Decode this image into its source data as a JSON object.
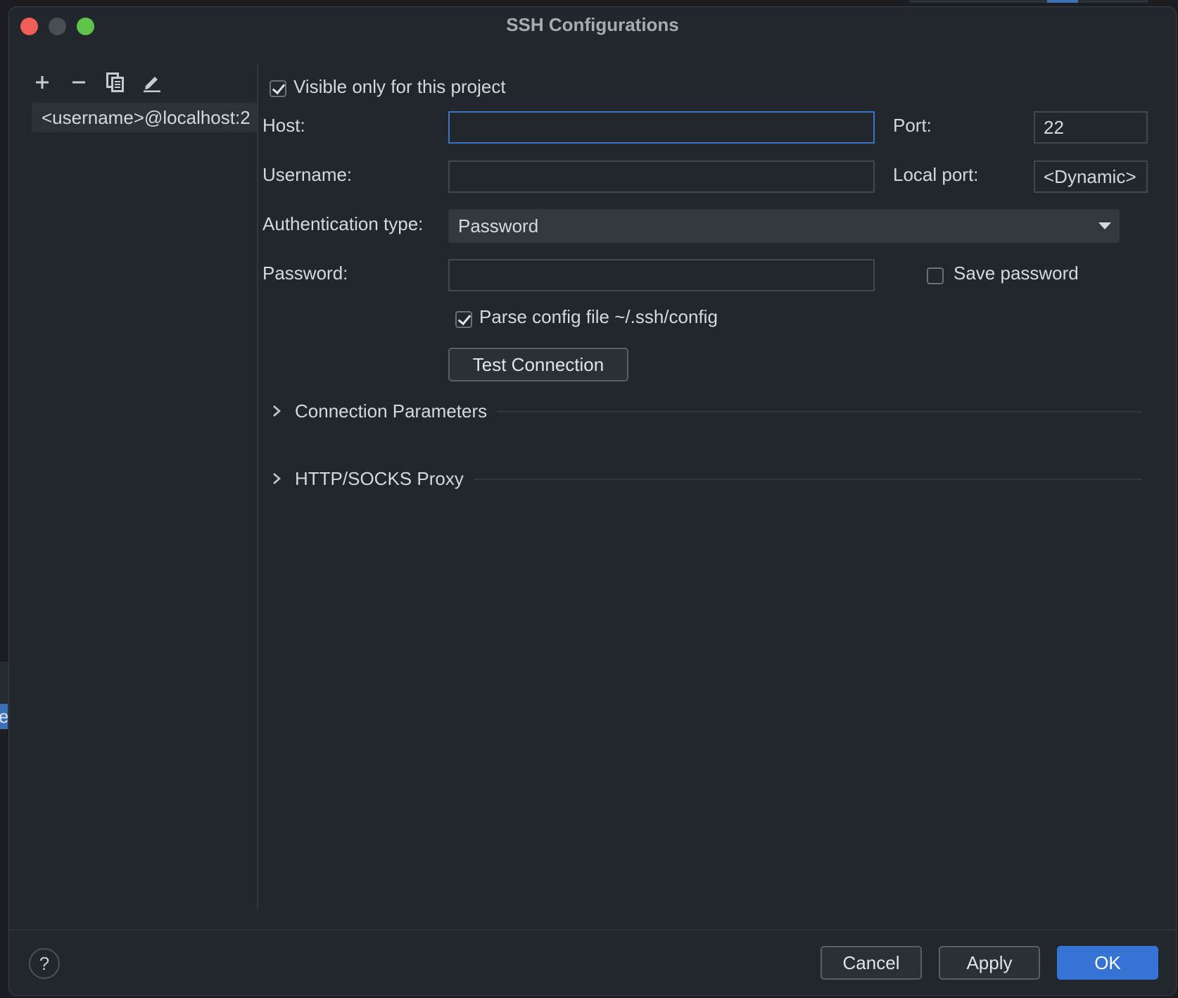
{
  "window": {
    "title": "SSH Configurations"
  },
  "backdrop": {
    "selected_fragment": "e"
  },
  "sidebar": {
    "toolbar": [
      {
        "name": "add-icon"
      },
      {
        "name": "remove-icon"
      },
      {
        "name": "copy-icon"
      },
      {
        "name": "edit-icon"
      }
    ],
    "items": [
      {
        "label": "<username>@localhost:2"
      }
    ]
  },
  "form": {
    "visible_only": {
      "label": "Visible only for this project",
      "checked": true
    },
    "host": {
      "label": "Host:",
      "value": ""
    },
    "port": {
      "label": "Port:",
      "value": "22"
    },
    "username": {
      "label": "Username:",
      "value": ""
    },
    "local_port": {
      "label": "Local port:",
      "value": "<Dynamic>"
    },
    "auth_type": {
      "label": "Authentication type:",
      "value": "Password"
    },
    "password": {
      "label": "Password:",
      "value": ""
    },
    "save_password": {
      "label": "Save password",
      "checked": false
    },
    "parse_config": {
      "label": "Parse config file ~/.ssh/config",
      "checked": true
    },
    "test_connection": {
      "label": "Test Connection"
    }
  },
  "sections": [
    {
      "label": "Connection Parameters",
      "expanded": false
    },
    {
      "label": "HTTP/SOCKS Proxy",
      "expanded": false
    }
  ],
  "footer": {
    "help": "?",
    "cancel": "Cancel",
    "apply": "Apply",
    "ok": "OK"
  },
  "colors": {
    "accent": "#3574d4",
    "focus_border": "#3b73c5",
    "background": "#22262d"
  }
}
